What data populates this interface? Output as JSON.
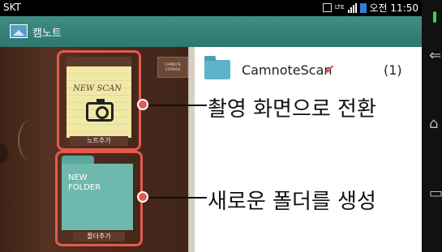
{
  "status_bar": {
    "carrier": "SKT",
    "network": "LTE",
    "time": "오전 11:50"
  },
  "app": {
    "title": "캠노트"
  },
  "left_panel": {
    "mini_tab_label": "CAMNOTE STORAGE",
    "notebook_cover_text": "NEW SCAN",
    "notebook_button_label": "노트추가",
    "folder_cover_text_1": "NEW",
    "folder_cover_text_2": "FOLDER",
    "folder_button_label": "폴더추가"
  },
  "list": {
    "items": [
      {
        "name": "CamnoteScan",
        "checkmark": "✔",
        "count": "(1)"
      }
    ]
  },
  "annotations": {
    "camera": "촬영 화면으로 전환",
    "folder": "새로운 폴더를 생성"
  },
  "colors": {
    "highlight": "#e35a4d",
    "app_bar": "#2f766f",
    "folder_icon": "#5fb3c8"
  }
}
